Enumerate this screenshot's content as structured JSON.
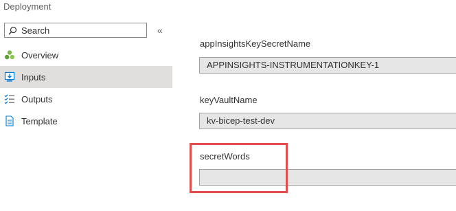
{
  "breadcrumb": "Deployment",
  "search": {
    "placeholder": "Search"
  },
  "collapse_glyph": "«",
  "nav": {
    "items": [
      {
        "label": "Overview",
        "icon": "overview-icon"
      },
      {
        "label": "Inputs",
        "icon": "inputs-icon",
        "active": true
      },
      {
        "label": "Outputs",
        "icon": "outputs-icon"
      },
      {
        "label": "Template",
        "icon": "template-icon"
      }
    ]
  },
  "fields": [
    {
      "label": "appInsightsKeySecretName",
      "value": "APPINSIGHTS-INSTRUMENTATIONKEY-1"
    },
    {
      "label": "keyVaultName",
      "value": "kv-bicep-test-dev"
    },
    {
      "label": "secretWords",
      "value": ""
    }
  ],
  "colors": {
    "highlight": "#e24e4e",
    "active_nav_bg": "#e1dfdd",
    "input_bg": "#e6e6e6"
  }
}
